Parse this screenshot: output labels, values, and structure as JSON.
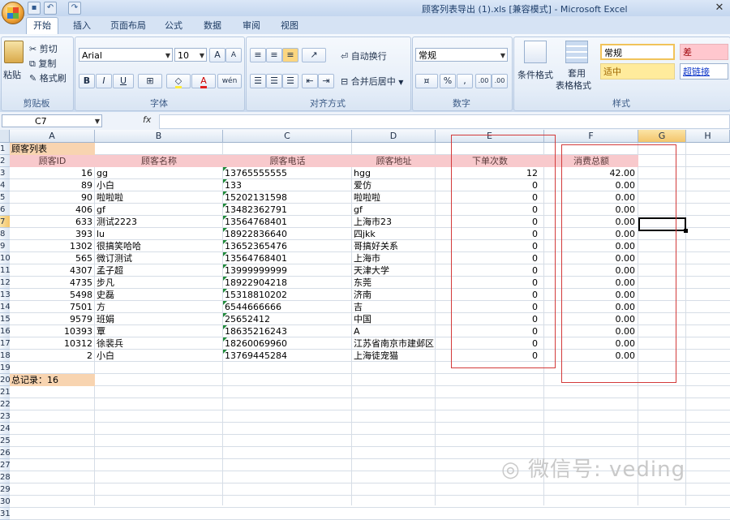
{
  "window": {
    "title": "顾客列表导出 (1).xls  [兼容模式] - Microsoft Excel",
    "close": "✕"
  },
  "tabs": [
    "开始",
    "插入",
    "页面布局",
    "公式",
    "数据",
    "审阅",
    "视图"
  ],
  "ribbon": {
    "clipboard": {
      "paste": "粘贴",
      "cut": "剪切",
      "copy": "复制",
      "format_painter": "格式刷",
      "label": "剪贴板"
    },
    "font": {
      "name": "Arial",
      "size": "10",
      "grow": "A",
      "shrink": "A",
      "bold": "B",
      "italic": "I",
      "underline": "U",
      "font_color": "A",
      "pinyin": "wén",
      "label": "字体"
    },
    "alignment": {
      "wrap": "自动换行",
      "merge": "合并后居中",
      "label": "对齐方式"
    },
    "number": {
      "format": "常规",
      "percent": "%",
      "comma": ",",
      "inc_decimal": ".00",
      "dec_decimal": ".00",
      "label": "数字"
    },
    "styles": {
      "cond_format": "条件格式",
      "table_format": "套用",
      "table_format2": "表格格式",
      "normal": "常规",
      "bad": "差",
      "neutral": "适中",
      "hyperlink": "超链接",
      "label": "样式"
    }
  },
  "formula_bar": {
    "cell_ref": "C7",
    "fx": "fx",
    "value": ""
  },
  "columns": [
    "A",
    "B",
    "C",
    "D",
    "E",
    "F",
    "G",
    "H"
  ],
  "rows": [
    "1",
    "2",
    "3",
    "4",
    "5",
    "6",
    "7",
    "8",
    "9",
    "10",
    "11",
    "12",
    "13",
    "14",
    "15",
    "16",
    "17",
    "18",
    "19",
    "20",
    "21",
    "22",
    "23",
    "24",
    "25",
    "26",
    "27",
    "28",
    "29",
    "30",
    "31"
  ],
  "sheet": {
    "title": "顾客列表",
    "headers": [
      "顾客ID",
      "顾客名称",
      "顾客电话",
      "顾客地址",
      "下单次数",
      "消费总额"
    ],
    "data": [
      [
        "16",
        "gg",
        "13765555555",
        "hgg",
        "12",
        "42.00"
      ],
      [
        "89",
        "小白",
        "133",
        "爱仿",
        "0",
        "0.00"
      ],
      [
        "90",
        "啦啦啦",
        "15202131598",
        "啦啦啦",
        "0",
        "0.00"
      ],
      [
        "406",
        "gf",
        "13482362791",
        "gf",
        "0",
        "0.00"
      ],
      [
        "633",
        "测试2223",
        "13564768401",
        "上海市23",
        "0",
        "0.00"
      ],
      [
        "393",
        "lu",
        "18922836640",
        "四jkk",
        "0",
        "0.00"
      ],
      [
        "1302",
        "很搞笑哈哈",
        "13652365476",
        "哥搞好关系",
        "0",
        "0.00"
      ],
      [
        "565",
        "微订测试",
        "13564768401",
        "上海市",
        "0",
        "0.00"
      ],
      [
        "4307",
        "孟子超",
        "13999999999",
        "天津大学",
        "0",
        "0.00"
      ],
      [
        "4735",
        "步凡",
        "18922904218",
        "东莞",
        "0",
        "0.00"
      ],
      [
        "5498",
        "史磊",
        "15318810202",
        "济南",
        "0",
        "0.00"
      ],
      [
        "7501",
        "方",
        "6544666666",
        "吉",
        "0",
        "0.00"
      ],
      [
        "9579",
        "班娟",
        "25652412",
        "中国",
        "0",
        "0.00"
      ],
      [
        "10393",
        "覃",
        "18635216243",
        "A",
        "0",
        "0.00"
      ],
      [
        "10312",
        "徐裴兵",
        "18260069960",
        "江苏省南京市建邺区",
        "0",
        "0.00"
      ],
      [
        "2",
        "小白",
        "13769445284",
        "上海徒宠猫",
        "0",
        "0.00"
      ]
    ],
    "total": "总记录：16"
  },
  "watermark": "微信号: veding",
  "colors": {
    "header_fill": "#f8c9cc",
    "title_fill": "#f8d4b0",
    "highlight": "#d33a3a"
  }
}
